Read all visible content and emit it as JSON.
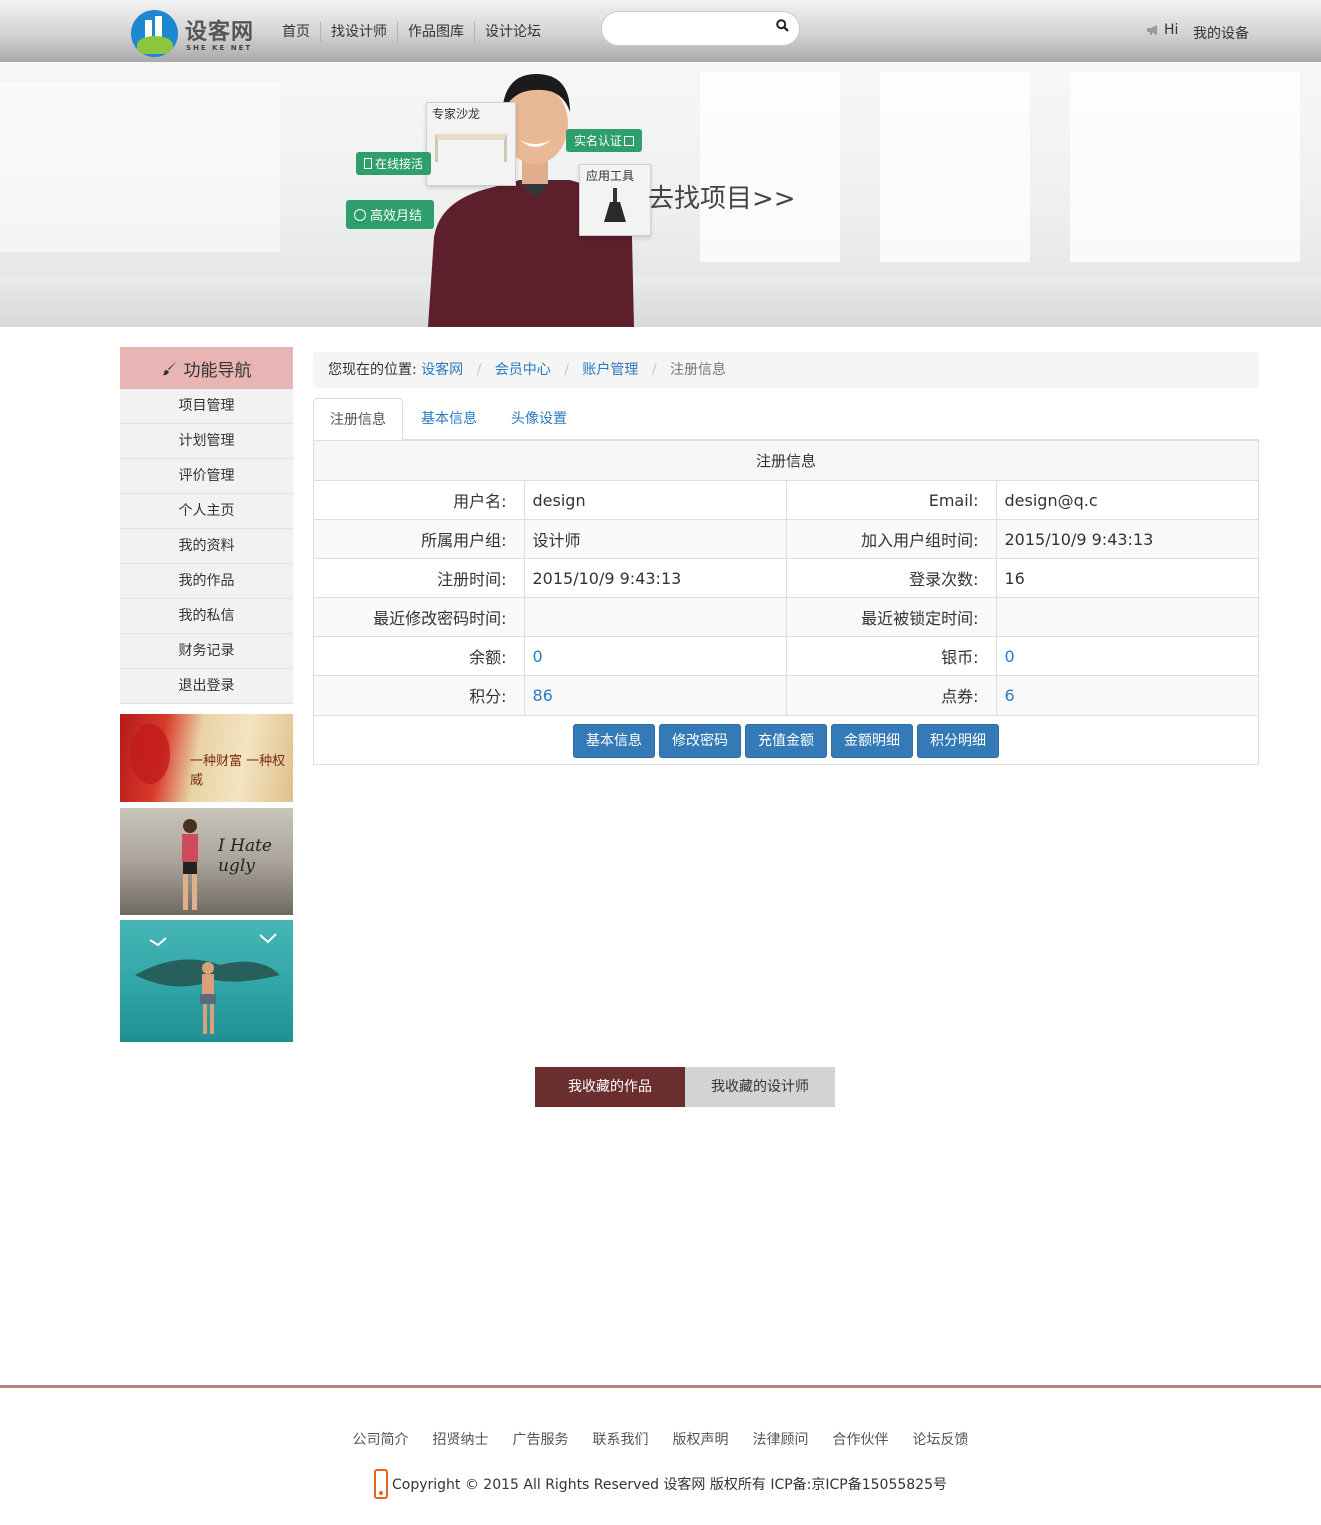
{
  "header": {
    "logo_cn": "设客网",
    "logo_en": "SHE KE NET",
    "nav": [
      "首页",
      "找设计师",
      "作品图库",
      "设计论坛"
    ],
    "search_placeholder": "",
    "hi": "Hi",
    "my_device": "我的设备"
  },
  "banner": {
    "tag_online": "在线接活",
    "tag_monthly": "高效月结",
    "tag_realname": "实名认证",
    "card_salon": "专家沙龙",
    "card_tools": "应用工具",
    "cta": "去找项目>>"
  },
  "sidebar": {
    "title": "功能导航",
    "items": [
      "项目管理",
      "计划管理",
      "评价管理",
      "个人主页",
      "我的资料",
      "我的作品",
      "我的私信",
      "财务记录",
      "退出登录"
    ],
    "ad1_text": "一种财富 一种权威",
    "ad2_text": "I Hate ugly"
  },
  "breadcrumb": {
    "prefix": "您现在的位置:",
    "links": [
      "设客网",
      "会员中心",
      "账户管理"
    ],
    "current": "注册信息"
  },
  "tabs": [
    "注册信息",
    "基本信息",
    "头像设置"
  ],
  "info": {
    "title": "注册信息",
    "rows": [
      {
        "l1": "用户名:",
        "v1": "design",
        "l2": "Email:",
        "v2": "design@q.c"
      },
      {
        "l1": "所属用户组:",
        "v1": "设计师",
        "l2": "加入用户组时间:",
        "v2": "2015/10/9 9:43:13"
      },
      {
        "l1": "注册时间:",
        "v1": "2015/10/9 9:43:13",
        "l2": "登录次数:",
        "v2": "16"
      },
      {
        "l1": "最近修改密码时间:",
        "v1": "",
        "l2": "最近被锁定时间:",
        "v2": ""
      },
      {
        "l1": "余额:",
        "v1": "0",
        "l2": "银币:",
        "v2": "0"
      },
      {
        "l1": "积分:",
        "v1": "86",
        "l2": "点券:",
        "v2": "6"
      }
    ],
    "buttons": [
      "基本信息",
      "修改密码",
      "充值金额",
      "金额明细",
      "积分明细"
    ]
  },
  "favorites": {
    "works": "我收藏的作品",
    "designers": "我收藏的设计师"
  },
  "footer": {
    "links": [
      "公司简介",
      "招贤纳士",
      "广告服务",
      "联系我们",
      "版权声明",
      "法律顾问",
      "合作伙伴",
      "论坛反馈"
    ],
    "copyright": "Copyright © 2015 All Rights Reserved 设客网 版权所有 ICP备:京ICP备15055825号"
  },
  "colors": {
    "accent": "#2a7ac0",
    "nav_head": "#e9b4b4",
    "fav_active": "#6b2e2e",
    "footer_line": "#c27c7c"
  }
}
